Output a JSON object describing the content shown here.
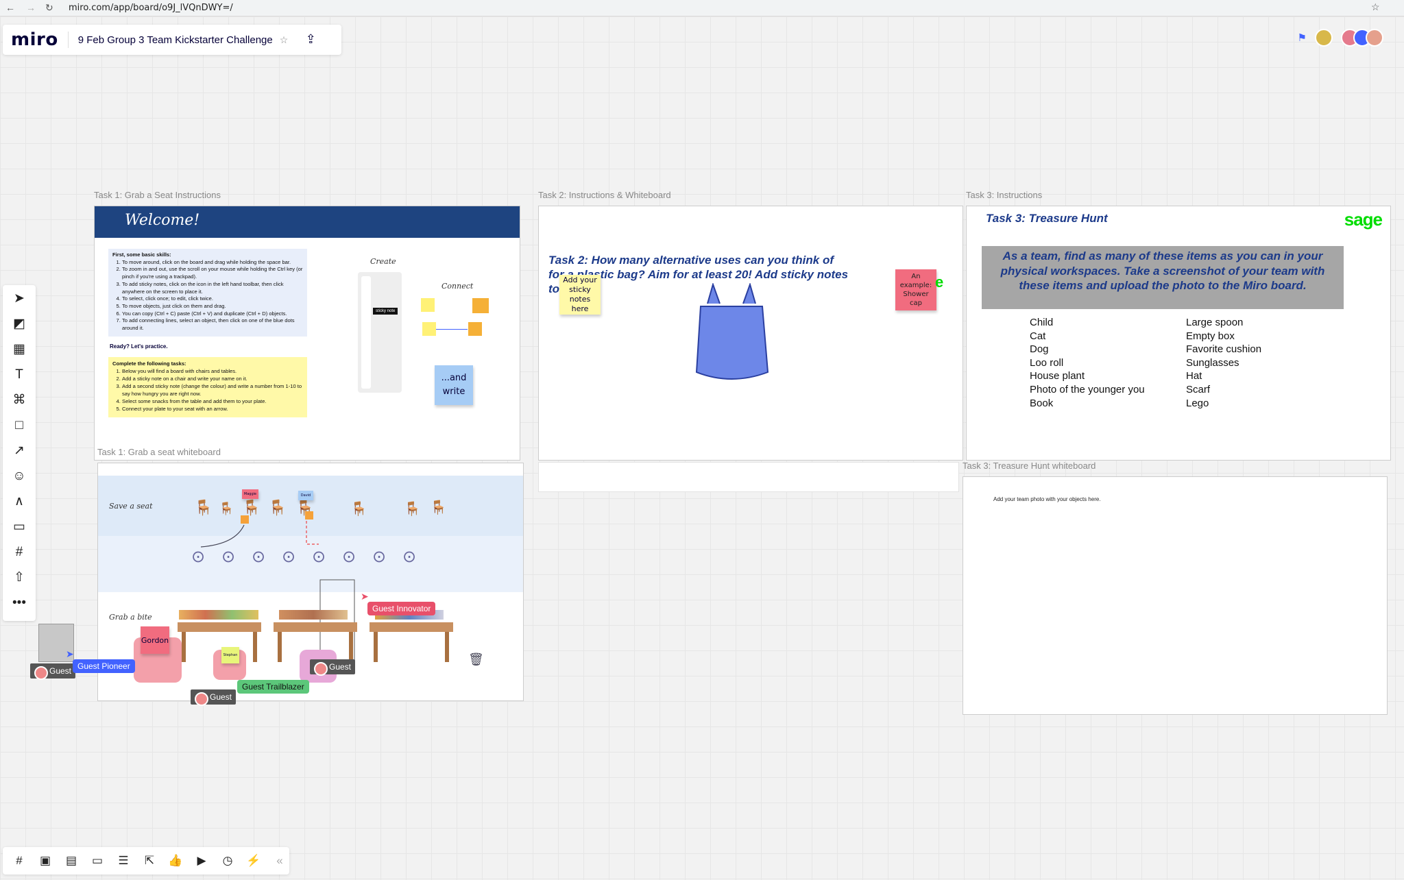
{
  "browser": {
    "url": "miro.com/app/board/o9J_lVQnDWY=/"
  },
  "header": {
    "logo": "miro",
    "board_title": "9 Feb Group 3 Team Kickstarter Challenge"
  },
  "frames": {
    "task1_instr": {
      "label": "Task 1: Grab a Seat Instructions",
      "welcome": "Welcome!",
      "basic_title": "First, some basic skills:",
      "basic_items": [
        "To move around, click on the board and drag while holding the space bar.",
        "To zoom in and out, use the scroll on your mouse while holding the Ctrl key (or pinch if you're using a trackpad).",
        "To add sticky notes, click on the icon in the left hand toolbar, then click anywhere on the screen to place it.",
        "To select, click once; to edit, click twice.",
        "To move objects, just click on them and drag.",
        "You can copy (Ctrl + C) paste (Ctrl + V) and duplicate (Ctrl + D) objects.",
        "To add connecting lines, select an object, then click on one of the blue dots around it."
      ],
      "ready": "Ready? Let's practice.",
      "tasks_title": "Complete the following tasks:",
      "tasks_items": [
        "Below you will find a board with chairs and tables.",
        "Add a sticky note on a chair and write your name on it.",
        "Add a second sticky note (change the colour) and write a number from 1-10 to say how hungry you are right now.",
        "Select some snacks from the table and add them to your plate.",
        "Connect your plate to your seat with an arrow."
      ],
      "create": "Create",
      "connect": "Connect",
      "sticky_tag": "sticky note",
      "and_write": "...and write"
    },
    "task1_wb": {
      "label": "Task 1: Grab a seat whiteboard",
      "save_seat": "Save a seat",
      "grab_bite": "Grab a bite",
      "note_maggie": "Maggie",
      "note_david": "David",
      "note_gordon": "Gordon",
      "note_stephan": "Stephan"
    },
    "task2": {
      "label": "Task 2: Instructions & Whiteboard",
      "question": "Task 2: How many alternative uses can you think of for a plastic bag? Aim for at least 20! Add sticky notes to th",
      "sticky_yellow": "Add your sticky notes here",
      "sticky_pink": "An example: Shower cap"
    },
    "task3": {
      "label": "Task 3: Instructions",
      "title": "Task 3: Treasure Hunt",
      "brand": "sage",
      "banner": "As a team, find as many of these items as you can in your physical workspaces. Take a screenshot of your team with these items and upload the photo to the Miro board.",
      "list_left": [
        "Child",
        "Cat",
        "Dog",
        "Loo roll",
        "House plant",
        "Photo of the younger you",
        "Book"
      ],
      "list_right": [
        "Large spoon",
        "Empty box",
        "Favorite cushion",
        "Sunglasses",
        "Hat",
        "Scarf",
        "Lego"
      ]
    },
    "task3_wb": {
      "label": "Task 3: Treasure Hunt whiteboard",
      "hint": "Add your team photo with your objects here."
    }
  },
  "cursors": {
    "pioneer": "Guest Pioneer",
    "innovator": "Guest Innovator",
    "trailblazer": "Guest Trailblazer",
    "guest": "Guest"
  },
  "colors": {
    "accent": "#4262ff",
    "welcome_bar": "#1e4480",
    "sage": "#00dc00",
    "yellow_note": "#fff9a8",
    "pink_note": "#f16c7f",
    "blue_note": "#a6ccf5"
  }
}
